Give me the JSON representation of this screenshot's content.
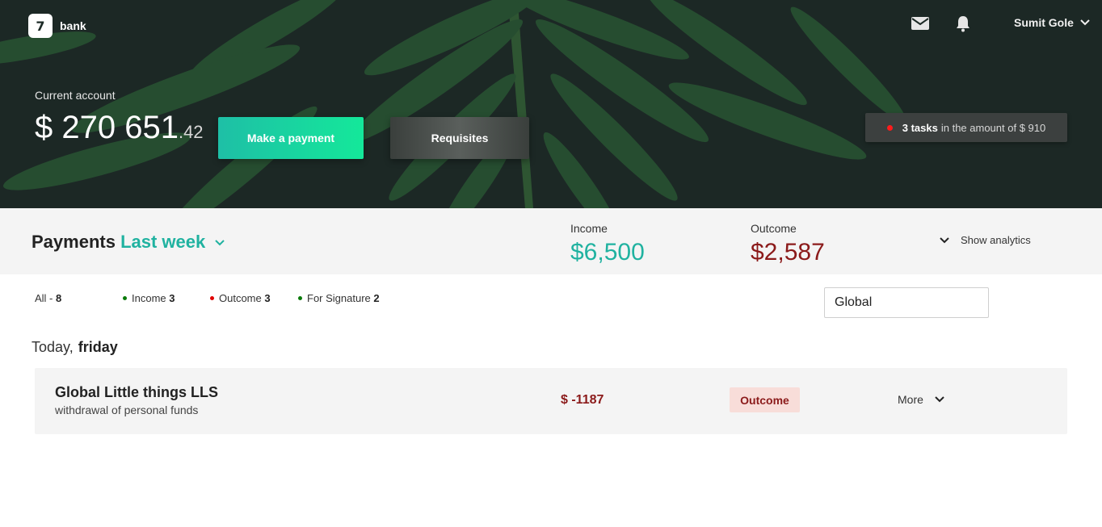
{
  "header": {
    "logo_mark": "7",
    "logo_text": "bank",
    "user_name": "Sumit Gole",
    "icons": [
      "mail-icon",
      "bell-icon",
      "chevron-down-icon"
    ]
  },
  "account": {
    "label": "Current account",
    "balance_main": "$ 270 651",
    "balance_cents": ".42",
    "pay_button": "Make a payment",
    "requisites_button": "Requisites"
  },
  "tasks": {
    "count_text": "3 tasks",
    "amount_text": "in the amount of $ 910"
  },
  "payments": {
    "title": "Payments",
    "period": "Last week",
    "income_label": "Income",
    "income_value": "$6,500",
    "outcome_label": "Outcome",
    "outcome_value": "$2,587",
    "analytics_label": "Show analytics"
  },
  "filters": {
    "all_label": "All - ",
    "all_count": "8",
    "income_label": "Income ",
    "income_count": "3",
    "outcome_label": "Outcome ",
    "outcome_count": "3",
    "signature_label": "For Signature ",
    "signature_count": "2",
    "search_value": "Global"
  },
  "day": {
    "prefix": "Today,",
    "name": "friday"
  },
  "transactions": [
    {
      "name": "Global Little things LLS",
      "description": "withdrawal of personal funds",
      "amount": "$ -1187",
      "status": "Outcome",
      "more_label": "More"
    }
  ],
  "colors": {
    "accent": "#20b2a0",
    "outcome": "#8b1a1a",
    "income_dot": "#0a7a0a",
    "outcome_dot": "#e00000",
    "task_dot": "#ff1b1b"
  }
}
